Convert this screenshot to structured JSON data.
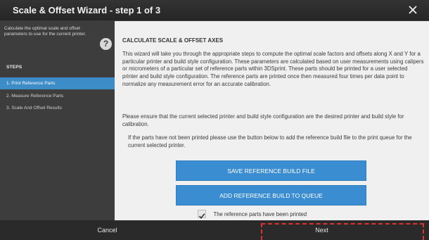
{
  "window": {
    "title": "Scale & Offset Wizard - step 1 of 3"
  },
  "sidebar": {
    "description": "Calculate the optimal scale and offset parameters to use for the current printer.",
    "help_glyph": "?",
    "steps_heading": "STEPS",
    "steps": [
      {
        "label": "1. Print Reference Parts",
        "active": true
      },
      {
        "label": "2. Measure Reference Parts",
        "active": false
      },
      {
        "label": "3. Scale And Offset Results",
        "active": false
      }
    ]
  },
  "main": {
    "heading": "CALCULATE SCALE & OFFSET AXES",
    "paragraph_1": "This wizard will take you through the appropriate steps to compute the optimal scale factors and offsets along X and Y for a particular printer and build style configuration. These parameters are calculated based on user measurements using calipers or micrometers of a particular set of reference parts within 3DSprint. These parts should be printed for a user selected printer and build style configuration. The reference parts are printed once then measured four times per data point to normalize any measurement error for an accurate calibration.",
    "paragraph_2": "Please ensure that the current selected printer and build style configuration are the desired printer and build style for calibration.",
    "paragraph_3": "If the parts have not been printed please use the button below to add the reference build file to the print queue for the current selected printer.",
    "save_button": "SAVE REFERENCE BUILD FILE",
    "add_button": "ADD REFERENCE BUILD TO QUEUE",
    "checkbox_checked": true,
    "checkbox_label": "The reference parts have been printed"
  },
  "footer": {
    "cancel_label": "Cancel",
    "next_label": "Next"
  },
  "colors": {
    "accent": "#3a8dd0",
    "highlight_dash": "#e03030"
  },
  "icons": {
    "close": "close-icon",
    "help": "help-icon",
    "checkmark": "checkmark-icon"
  }
}
